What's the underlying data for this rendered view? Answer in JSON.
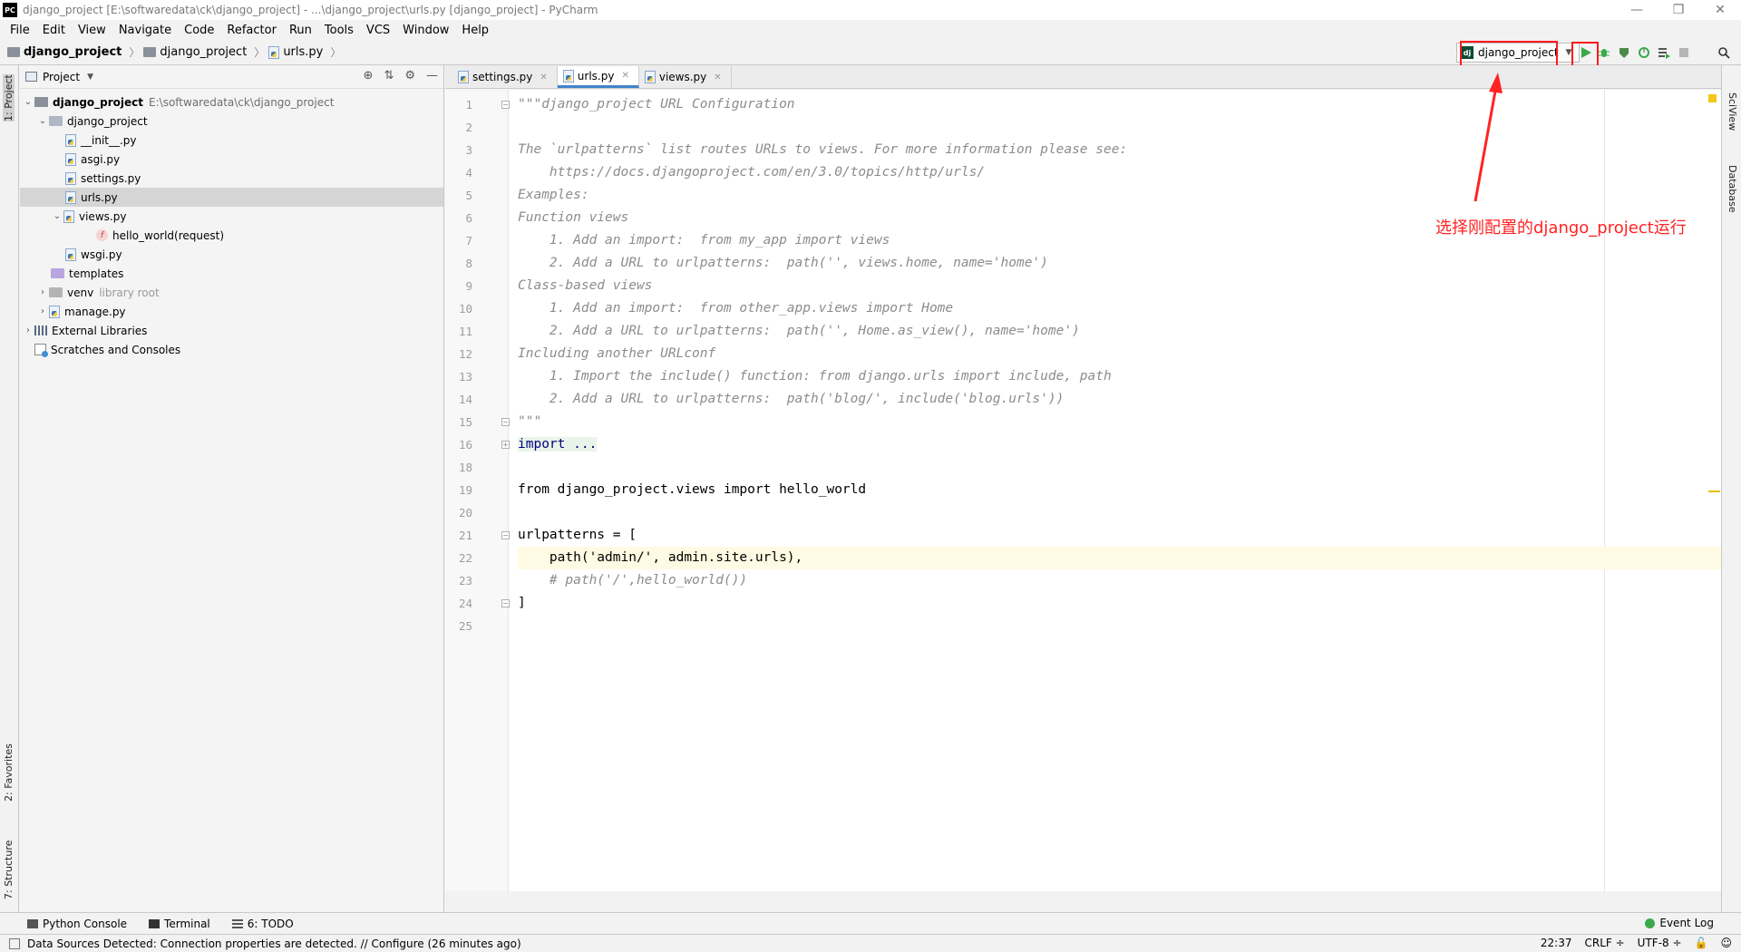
{
  "titlebar": {
    "logo": "PC",
    "title": "django_project [E:\\softwaredata\\ck\\django_project] - ...\\django_project\\urls.py [django_project] - PyCharm",
    "minimize": "—",
    "restore": "❐",
    "close": "✕"
  },
  "menu": [
    "File",
    "Edit",
    "View",
    "Navigate",
    "Code",
    "Refactor",
    "Run",
    "Tools",
    "VCS",
    "Window",
    "Help"
  ],
  "breadcrumb": [
    "django_project",
    "django_project",
    "urls.py"
  ],
  "run_config": {
    "icon": "dj",
    "label": "django_project"
  },
  "toolbar_icons": [
    "run-icon",
    "debug-icon",
    "coverage-icon",
    "profile-icon",
    "concurrency-icon",
    "stop-icon",
    "search-icon"
  ],
  "left_stripe": {
    "project": "1: Project",
    "favorites": "2: Favorites",
    "structure": "7: Structure"
  },
  "right_stripe": {
    "sciview": "SciView",
    "database": "Database"
  },
  "project_panel": {
    "title": "Project",
    "tree": [
      {
        "label": "django_project",
        "hint": "E:\\softwaredata\\ck\\django_project",
        "type": "folder",
        "depth": 0,
        "expanded": true,
        "bold": true
      },
      {
        "label": "django_project",
        "type": "folder",
        "depth": 1,
        "expanded": true
      },
      {
        "label": "__init__.py",
        "type": "py",
        "depth": 2
      },
      {
        "label": "asgi.py",
        "type": "py",
        "depth": 2
      },
      {
        "label": "settings.py",
        "type": "py",
        "depth": 2
      },
      {
        "label": "urls.py",
        "type": "py",
        "depth": 2,
        "selected": true
      },
      {
        "label": "views.py",
        "type": "py",
        "depth": 2,
        "expanded": true
      },
      {
        "label": "hello_world(request)",
        "type": "func",
        "depth": 3
      },
      {
        "label": "wsgi.py",
        "type": "py",
        "depth": 2
      },
      {
        "label": "templates",
        "type": "folder-purple",
        "depth": 1
      },
      {
        "label": "venv",
        "hint": "library root",
        "type": "folder-gray",
        "depth": 1,
        "collapsed": true
      },
      {
        "label": "manage.py",
        "type": "py",
        "depth": 1,
        "collapsed": true
      },
      {
        "label": "External Libraries",
        "type": "lib",
        "depth": 0,
        "collapsed": true
      },
      {
        "label": "Scratches and Consoles",
        "type": "scratch",
        "depth": 0
      }
    ]
  },
  "editor": {
    "tabs": [
      {
        "label": "settings.py",
        "active": false
      },
      {
        "label": "urls.py",
        "active": true
      },
      {
        "label": "views.py",
        "active": false
      }
    ],
    "line_numbers": [
      "1",
      "2",
      "3",
      "4",
      "5",
      "6",
      "7",
      "8",
      "9",
      "10",
      "11",
      "12",
      "13",
      "14",
      "15",
      "16",
      "18",
      "19",
      "20",
      "21",
      "22",
      "23",
      "24",
      "25"
    ],
    "lines": [
      "\"\"\"django_project URL Configuration",
      "",
      "The `urlpatterns` list routes URLs to views. For more information please see:",
      "    https://docs.djangoproject.com/en/3.0/topics/http/urls/",
      "Examples:",
      "Function views",
      "    1. Add an import:  from my_app import views",
      "    2. Add a URL to urlpatterns:  path('', views.home, name='home')",
      "Class-based views",
      "    1. Add an import:  from other_app.views import Home",
      "    2. Add a URL to urlpatterns:  path('', Home.as_view(), name='home')",
      "Including another URLconf",
      "    1. Import the include() function: from django.urls import include, path",
      "    2. Add a URL to urlpatterns:  path('blog/', include('blog.urls'))",
      "\"\"\"",
      "import ...",
      "",
      "from django_project.views import hello_world",
      "",
      "urlpatterns = [",
      "    path('admin/', admin.site.urls),",
      "    # path('/',hello_world())",
      "]",
      ""
    ]
  },
  "annotation": "选择刚配置的django_project运行",
  "bottom_tools": [
    {
      "label": "Python Console"
    },
    {
      "label": "Terminal"
    },
    {
      "label": "6: TODO"
    }
  ],
  "event_log": "Event Log",
  "status": {
    "message": "Data Sources Detected: Connection properties are detected. // Configure (26 minutes ago)",
    "position": "22:37",
    "line_sep": "CRLF ÷",
    "encoding": "UTF-8 ÷"
  },
  "colors": {
    "accent": "#4083c9",
    "annotation": "#ff2323",
    "run_green": "#3aaa4a",
    "current_line": "#fffae3"
  }
}
